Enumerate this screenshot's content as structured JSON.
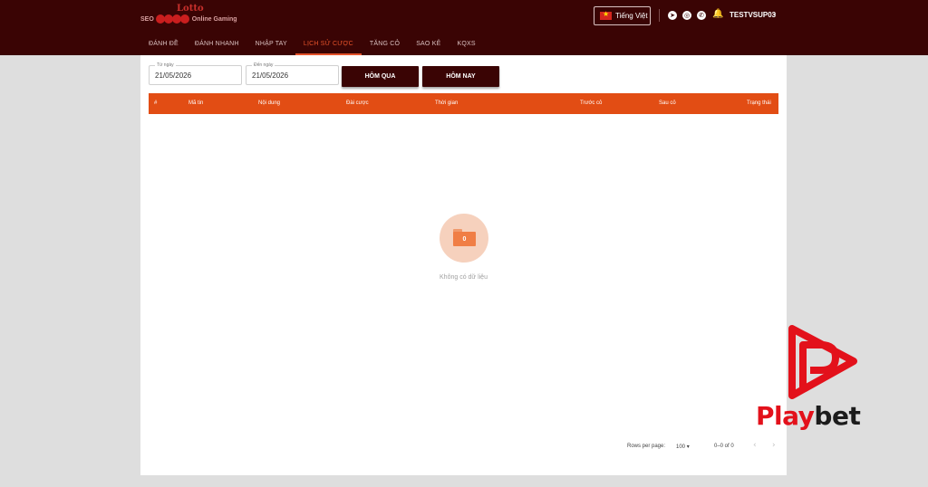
{
  "header": {
    "logo": {
      "title": "Lotto",
      "left_text": "SEO",
      "right_text": "Online Gaming"
    },
    "language_label": "Tiếng Việt",
    "icons": [
      "telegram-icon",
      "instagram-icon",
      "phone-icon",
      "bell-icon"
    ],
    "username": "TESTVSUP03",
    "colors": {
      "background": "#3a0404",
      "accent": "#e5522a"
    }
  },
  "nav": [
    {
      "label": "ĐÁNH ĐỀ",
      "active": false
    },
    {
      "label": "ĐÁNH NHANH",
      "active": false
    },
    {
      "label": "NHẬP TAY",
      "active": false
    },
    {
      "label": "LỊCH SỬ CƯỢC",
      "active": true
    },
    {
      "label": "TĂNG CỎ",
      "active": false
    },
    {
      "label": "SAO KÊ",
      "active": false
    },
    {
      "label": "KQXS",
      "active": false
    }
  ],
  "filters": {
    "from_label": "Từ ngày",
    "from_value": "21/05/2026",
    "to_label": "Đến ngày",
    "to_value": "21/05/2026",
    "yesterday_button": "HÔM QUA",
    "today_button": "HÔM NAY"
  },
  "table": {
    "header_color": "#e24d14",
    "columns": [
      "#",
      "Mã tin",
      "Nội dung",
      "Đài cược",
      "Thời gian",
      "Trước cỏ",
      "Sau cỏ",
      "Trạng thái"
    ],
    "rows": []
  },
  "empty_state": {
    "count": "0",
    "message": "Không có dữ liệu"
  },
  "pagination": {
    "rows_per_page_label": "Rows per page:",
    "rows_per_page_value": "100",
    "range_text": "0–0 of 0"
  },
  "watermark": {
    "part1": "Play",
    "part2": "bet",
    "color": "#e3111b"
  }
}
